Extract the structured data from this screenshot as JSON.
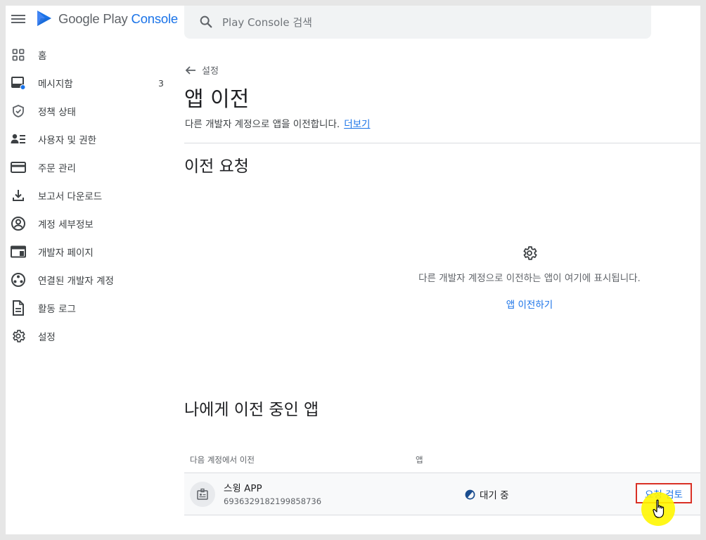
{
  "app": {
    "brand_prefix": "Google Play",
    "brand_suffix": "Console",
    "accent_color": "#1a73e8"
  },
  "search": {
    "placeholder": "Play Console 검색"
  },
  "sidebar": {
    "items": [
      {
        "label": "홈",
        "icon": "grid-icon"
      },
      {
        "label": "메시지함",
        "icon": "inbox-icon",
        "badge": "3"
      },
      {
        "label": "정책 상태",
        "icon": "shield-check-icon"
      },
      {
        "label": "사용자 및 권한",
        "icon": "users-icon"
      },
      {
        "label": "주문 관리",
        "icon": "credit-card-icon"
      },
      {
        "label": "보고서 다운로드",
        "icon": "download-icon"
      },
      {
        "label": "계정 세부정보",
        "icon": "account-circle-icon"
      },
      {
        "label": "개발자 페이지",
        "icon": "web-page-icon"
      },
      {
        "label": "연결된 개발자 계정",
        "icon": "linked-accounts-icon"
      },
      {
        "label": "활동 로그",
        "icon": "document-icon"
      },
      {
        "label": "설정",
        "icon": "gear-icon"
      }
    ]
  },
  "main": {
    "breadcrumb": "설정",
    "title": "앱 이전",
    "description": "다른 개발자 계정으로 앱을 이전합니다.",
    "learn_more": "더보기",
    "transfer_requests": {
      "title": "이전 요청",
      "empty_text": "다른 개발자 계정으로 이전하는 앱이 여기에 표시됩니다.",
      "empty_action": "앱 이전하기"
    },
    "incoming": {
      "title": "나에게 이전 중인 앱",
      "columns": [
        "다음 계정에서 이전",
        "앱"
      ],
      "rows": [
        {
          "app_name": "스윙 APP",
          "app_id": "6936329182199858736",
          "status": "대기 중",
          "action": "요청 검토"
        }
      ]
    }
  }
}
